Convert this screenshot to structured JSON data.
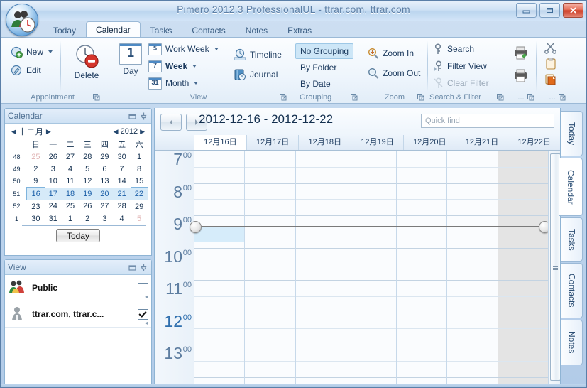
{
  "window": {
    "title": "Pimero 2012.3 ProfessionalUL - ttrar.com, ttrar.com",
    "minimize_label": "Minimize",
    "maximize_label": "Maximize",
    "close_label": "Close"
  },
  "ribbon_tabs": [
    {
      "label": "Today",
      "active": false
    },
    {
      "label": "Calendar",
      "active": true
    },
    {
      "label": "Tasks",
      "active": false
    },
    {
      "label": "Contacts",
      "active": false
    },
    {
      "label": "Notes",
      "active": false
    },
    {
      "label": "Extras",
      "active": false
    }
  ],
  "ribbon": {
    "appointment": {
      "group_label": "Appointment",
      "new_label": "New",
      "edit_label": "Edit",
      "delete_label": "Delete",
      "day_label": "Day",
      "day_number": "1"
    },
    "view": {
      "group_label": "View",
      "work_week_label": "Work Week",
      "work_week_number": "5",
      "week_label": "Week",
      "week_number": "7",
      "month_label": "Month",
      "month_number": "31",
      "timeline_label": "Timeline",
      "journal_label": "Journal"
    },
    "grouping": {
      "group_label": "Grouping",
      "items": [
        {
          "label": "No Grouping",
          "selected": true
        },
        {
          "label": "By Folder",
          "selected": false
        },
        {
          "label": "By Date",
          "selected": false
        }
      ]
    },
    "zoom": {
      "group_label": "Zoom",
      "zoom_in_label": "Zoom In",
      "zoom_out_label": "Zoom Out"
    },
    "search_filter": {
      "group_label": "Search & Filter",
      "search_label": "Search",
      "filter_view_label": "Filter View",
      "clear_filter_label": "Clear Filter"
    },
    "print": {
      "group_label": "..."
    },
    "clipboard": {
      "group_label": "..."
    }
  },
  "sidebar": {
    "calendar_panel": {
      "title": "Calendar",
      "month": "十二月",
      "year": "2012",
      "weekday_headers": [
        "日",
        "一",
        "二",
        "三",
        "四",
        "五",
        "六"
      ],
      "today_button": "Today",
      "weeks": [
        {
          "num": "48",
          "days": [
            "25",
            "26",
            "27",
            "28",
            "29",
            "30",
            "1"
          ],
          "dim": [
            true,
            true,
            true,
            true,
            true,
            true,
            false
          ],
          "selected": false
        },
        {
          "num": "49",
          "days": [
            "2",
            "3",
            "4",
            "5",
            "6",
            "7",
            "8"
          ],
          "dim": [
            false,
            false,
            false,
            false,
            false,
            false,
            false
          ],
          "selected": false
        },
        {
          "num": "50",
          "days": [
            "9",
            "10",
            "11",
            "12",
            "13",
            "14",
            "15"
          ],
          "dim": [
            false,
            false,
            false,
            false,
            false,
            false,
            false
          ],
          "selected": false
        },
        {
          "num": "51",
          "days": [
            "16",
            "17",
            "18",
            "19",
            "20",
            "21",
            "22"
          ],
          "dim": [
            false,
            false,
            false,
            false,
            false,
            false,
            false
          ],
          "selected": true
        },
        {
          "num": "52",
          "days": [
            "23",
            "24",
            "25",
            "26",
            "27",
            "28",
            "29"
          ],
          "dim": [
            false,
            false,
            false,
            false,
            false,
            false,
            false
          ],
          "selected": false
        },
        {
          "num": "1",
          "days": [
            "30",
            "31",
            "1",
            "2",
            "3",
            "4",
            "5"
          ],
          "dim": [
            false,
            false,
            true,
            true,
            true,
            true,
            true
          ],
          "selected": false
        }
      ]
    },
    "view_panel": {
      "title": "View",
      "rows": [
        {
          "label": "Public",
          "checked": false,
          "icon": "group-users-icon"
        },
        {
          "label": "ttrar.com, ttrar.c...",
          "checked": true,
          "icon": "single-user-icon"
        }
      ]
    }
  },
  "main": {
    "date_range": "2012-12-16 - 2012-12-22",
    "quick_find_placeholder": "Quick find",
    "quick_find_value": "",
    "prev_label": "Previous",
    "next_label": "Next",
    "day_columns": [
      {
        "label": "12月16日",
        "selected": true,
        "shaded": false
      },
      {
        "label": "12月17日",
        "selected": false,
        "shaded": false
      },
      {
        "label": "12月18日",
        "selected": false,
        "shaded": false
      },
      {
        "label": "12月19日",
        "selected": false,
        "shaded": false
      },
      {
        "label": "12月20日",
        "selected": false,
        "shaded": false
      },
      {
        "label": "12月21日",
        "selected": false,
        "shaded": false
      },
      {
        "label": "12月22日",
        "selected": false,
        "shaded": true
      }
    ],
    "time_slots": [
      {
        "hour": "7",
        "minutes": "00",
        "current": false
      },
      {
        "hour": "8",
        "minutes": "00",
        "current": false
      },
      {
        "hour": "9",
        "minutes": "00",
        "current": false
      },
      {
        "hour": "10",
        "minutes": "00",
        "current": false
      },
      {
        "hour": "11",
        "minutes": "00",
        "current": false
      },
      {
        "hour": "12",
        "minutes": "00",
        "current": true
      },
      {
        "hour": "13",
        "minutes": "00",
        "current": false
      }
    ]
  },
  "right_tabs": [
    {
      "label": "Today",
      "active": false
    },
    {
      "label": "Calendar",
      "active": true
    },
    {
      "label": "Tasks",
      "active": false
    },
    {
      "label": "Contacts",
      "active": false
    },
    {
      "label": "Notes",
      "active": false
    }
  ],
  "colors": {
    "accent": "#2f6fae",
    "selection": "#cde6f7",
    "weekend_text": "#c00000",
    "close_button": "#cc3d26"
  }
}
